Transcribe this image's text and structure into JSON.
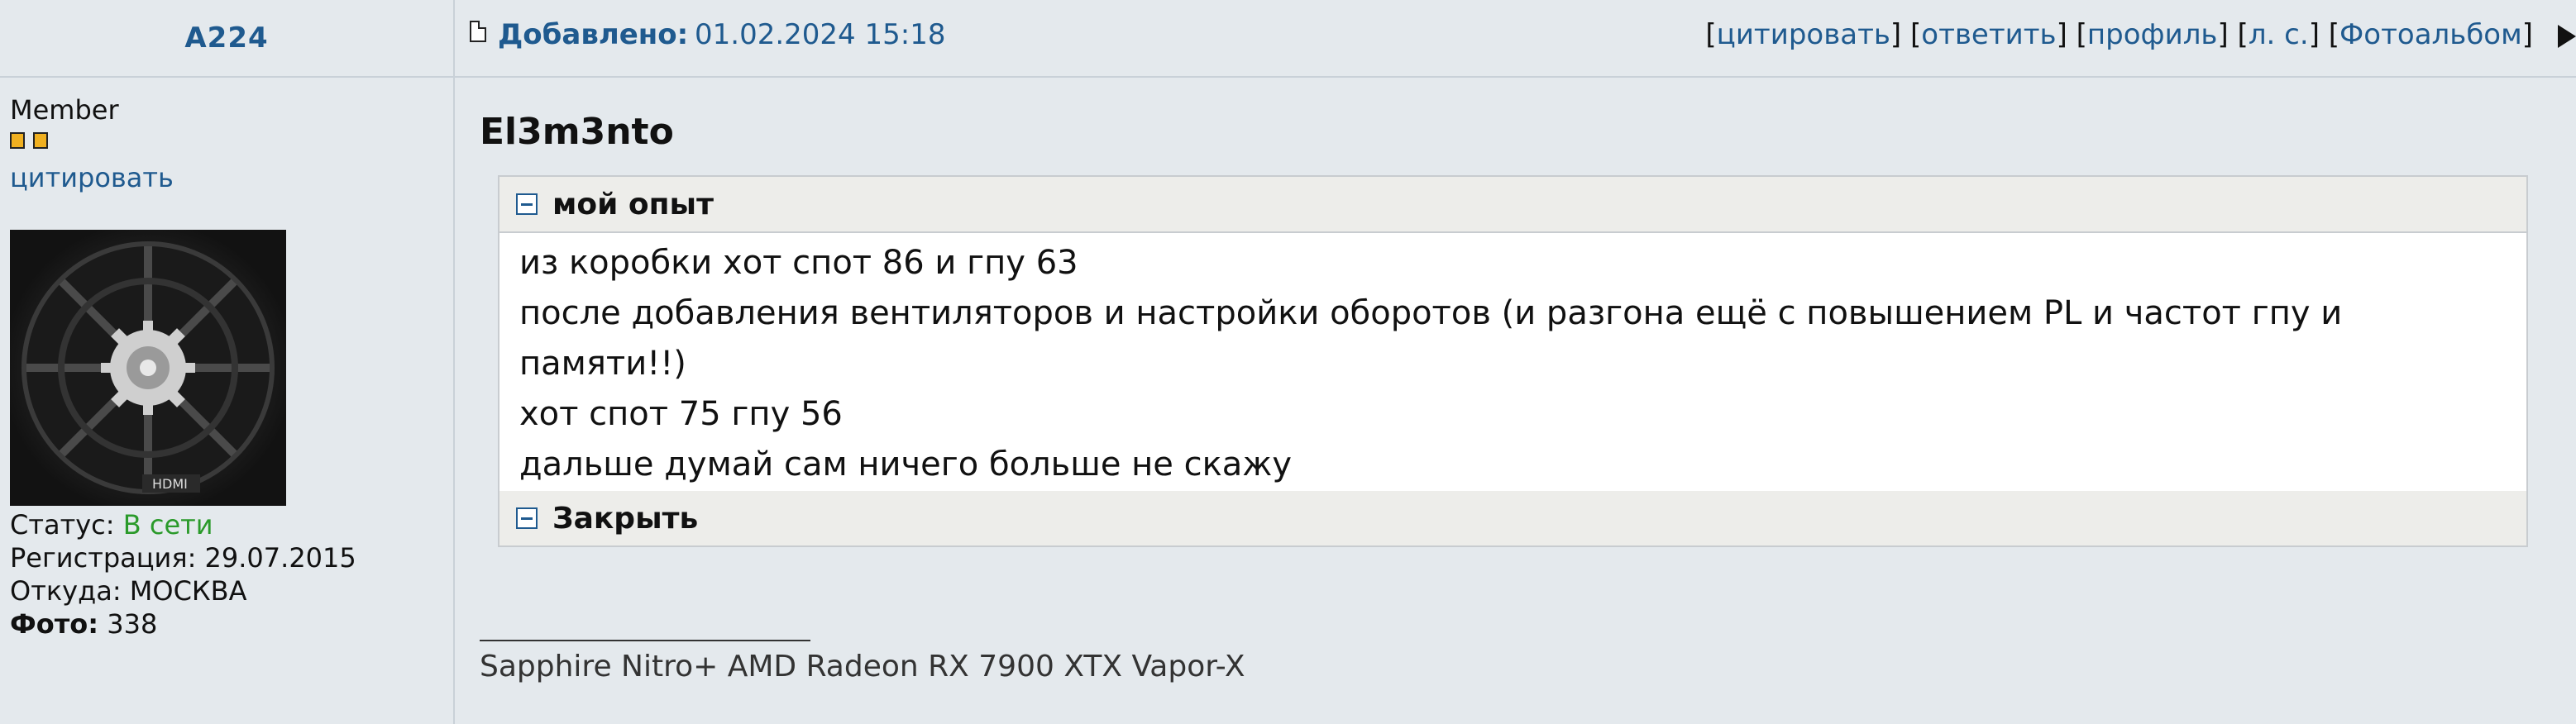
{
  "header": {
    "author": "A224",
    "added_label": "Добавлено:",
    "added_date": "01.02.2024 15:18",
    "actions": {
      "quote": "цитировать",
      "reply": "ответить",
      "profile": "профиль",
      "pm": "л. с.",
      "album": "Фотоальбом"
    }
  },
  "user": {
    "rank": "Member",
    "quote_link": "цитировать",
    "status_label": "Статус:",
    "status_value": "В сети",
    "status_color": "#2a9a2a",
    "reg_label": "Регистрация:",
    "reg_value": "29.07.2015",
    "from_label": "Откуда:",
    "from_value": "МОСКВА",
    "photo_label": "Фото:",
    "photo_value": "338",
    "avatar_text": "HDMI"
  },
  "post": {
    "title": "El3m3nto",
    "spoiler": {
      "header": "мой опыт",
      "lines": [
        "из коробки хот спот 86 и гпу 63",
        "после добавления вентиляторов и настройки оборотов (и разгона ещё с повышением PL и частот гпу и",
        "памяти!!)",
        "хот спот 75 гпу 56",
        "дальше думай сам ничего больше не скажу"
      ],
      "close": "Закрыть"
    },
    "signature": "Sapphire Nitro+ AMD Radeon RX 7900 XTX Vapor-X"
  }
}
